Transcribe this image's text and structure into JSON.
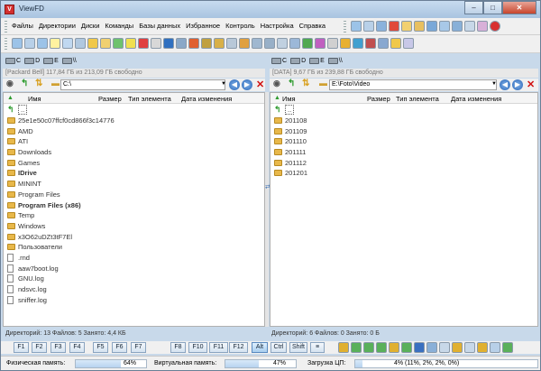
{
  "window": {
    "title": "ViewFD"
  },
  "menu": [
    "Файлы",
    "Директории",
    "Диски",
    "Команды",
    "Базы данных",
    "Избранное",
    "Контроль",
    "Настройка",
    "Справка"
  ],
  "left": {
    "drives": [
      "C",
      "D",
      "E",
      "\\\\"
    ],
    "free_space": "[Packard Bell]  117,84 ГБ из 213,09 ГБ свободно",
    "path": "C:\\",
    "columns": [
      "Имя",
      "Размер",
      "Тип элемента",
      "Дата изменения"
    ],
    "items": [
      {
        "name": "..",
        "kind": "up"
      },
      {
        "name": "25e1e50c07ffcf0cd866f3c14776",
        "kind": "folder"
      },
      {
        "name": "AMD",
        "kind": "folder"
      },
      {
        "name": "ATI",
        "kind": "folder"
      },
      {
        "name": "Downloads",
        "kind": "folder"
      },
      {
        "name": "Games",
        "kind": "folder"
      },
      {
        "name": "IDrive",
        "kind": "folder",
        "bold": true
      },
      {
        "name": "MININT",
        "kind": "folder"
      },
      {
        "name": "Program Files",
        "kind": "folder"
      },
      {
        "name": "Program Files (x86)",
        "kind": "folder",
        "bold": true
      },
      {
        "name": "Temp",
        "kind": "folder"
      },
      {
        "name": "Windows",
        "kind": "folder"
      },
      {
        "name": "x3O62uDZt3tF7El",
        "kind": "folder"
      },
      {
        "name": "Пользователи",
        "kind": "folder"
      },
      {
        "name": ".rnd",
        "kind": "file"
      },
      {
        "name": "aaw7boot.log",
        "kind": "file"
      },
      {
        "name": "GNU.log",
        "kind": "file"
      },
      {
        "name": "ndsvc.log",
        "kind": "file"
      },
      {
        "name": "sniffer.log",
        "kind": "file"
      }
    ],
    "status": "Директорий: 13   Файлов: 5   Занято: 4,4 КБ"
  },
  "right": {
    "drives": [
      "C",
      "D",
      "E",
      "\\\\"
    ],
    "free_space": "[DATA]  9,67 ГБ из 239,88 ГБ свободно",
    "path": "E:\\Foto\\Video",
    "columns": [
      "Имя",
      "Размер",
      "Тип элемента",
      "Дата изменения"
    ],
    "items": [
      {
        "name": "..",
        "kind": "up"
      },
      {
        "name": "201108",
        "kind": "folder"
      },
      {
        "name": "201109",
        "kind": "folder"
      },
      {
        "name": "201110",
        "kind": "folder"
      },
      {
        "name": "201111",
        "kind": "folder"
      },
      {
        "name": "201112",
        "kind": "folder"
      },
      {
        "name": "201201",
        "kind": "folder"
      }
    ],
    "status": "Директорий: 6   Файлов: 0   Занято: 0 Б"
  },
  "fkeys": [
    "F1",
    "F2",
    "F3",
    "F4",
    "F5",
    "F6",
    "F7",
    "F8",
    "F10",
    "F11",
    "F12",
    "Alt",
    "Ctrl",
    "Shift"
  ],
  "memory": {
    "physical_label": "Физическая память:",
    "physical_value": "64%",
    "physical_pct": 64,
    "virtual_label": "Виртуальная память:",
    "virtual_value": "47%",
    "virtual_pct": 47,
    "cpu_label": "Загрузка ЦП:",
    "cpu_value": "4% (11%, 2%, 2%, 0%)",
    "cpu_pct": 4
  }
}
